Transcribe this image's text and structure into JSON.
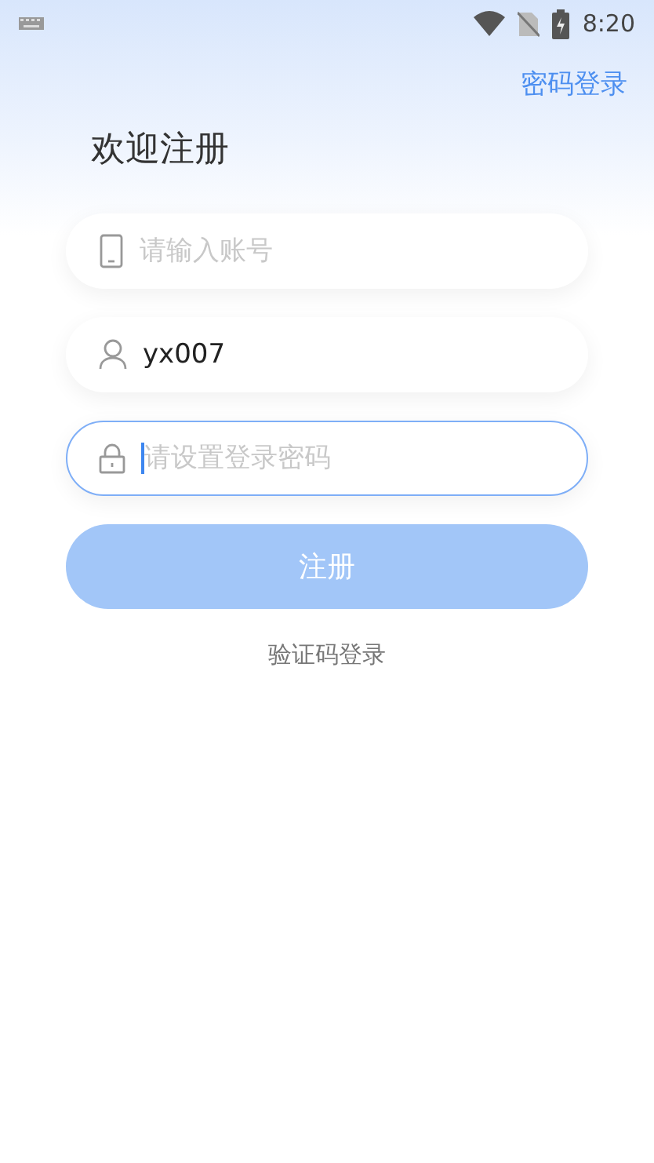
{
  "status_bar": {
    "time": "8:20"
  },
  "top_link": "密码登录",
  "title": "欢迎注册",
  "fields": [
    {
      "kind": "phone",
      "placeholder": "请输入账号",
      "focused": false
    },
    {
      "kind": "user",
      "value": "yx007",
      "focused": false
    },
    {
      "kind": "lock",
      "placeholder": "请设置登录密码",
      "focused": true
    }
  ],
  "submit": {
    "label": "注册",
    "disabled": true
  },
  "alt_link": "验证码登录"
}
